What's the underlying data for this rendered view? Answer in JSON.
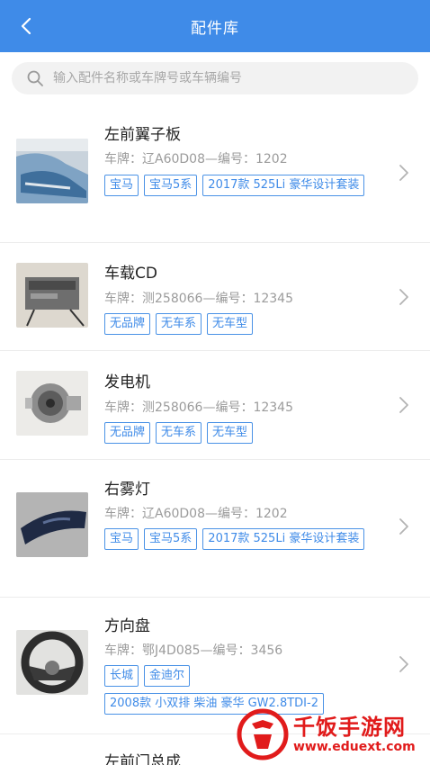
{
  "header": {
    "title": "配件库"
  },
  "search": {
    "placeholder": "输入配件名称或车牌号或车辆编号"
  },
  "parts": [
    {
      "name": "左前翼子板",
      "meta": "车牌：辽A60D08—编号：1202",
      "tags": [
        "宝马",
        "宝马5系"
      ],
      "model": "2017款 525Li 豪华设计套装"
    },
    {
      "name": "车载CD",
      "meta": "车牌：测258066—编号：12345",
      "tags": [
        "无品牌",
        "无车系",
        "无车型"
      ],
      "model": ""
    },
    {
      "name": "发电机",
      "meta": "车牌：测258066—编号：12345",
      "tags": [
        "无品牌",
        "无车系",
        "无车型"
      ],
      "model": ""
    },
    {
      "name": "右雾灯",
      "meta": "车牌：辽A60D08—编号：1202",
      "tags": [
        "宝马",
        "宝马5系"
      ],
      "model": "2017款 525Li 豪华设计套装"
    },
    {
      "name": "方向盘",
      "meta": "车牌：鄂J4D085—编号：3456",
      "tags": [
        "长城",
        "金迪尔"
      ],
      "model": "2008款 小双排 柴油 豪华 GW2.8TDI-2"
    },
    {
      "name": "左前门总成",
      "meta": "",
      "tags": [],
      "model": ""
    }
  ],
  "watermark": {
    "text": "千饭手游网",
    "url": "www.eduext.com"
  },
  "colors": {
    "accent": "#3f8be8",
    "tag_border": "#4a92e6",
    "watermark": "#e11b1b"
  }
}
